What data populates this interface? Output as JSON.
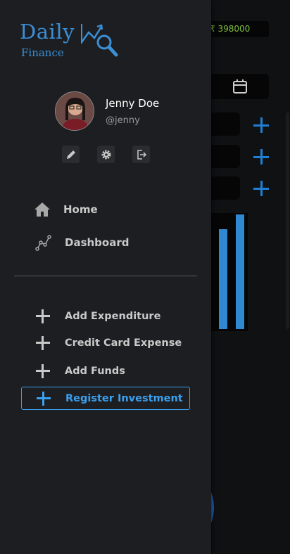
{
  "app": {
    "logo_title": "Daily",
    "logo_subtitle": "Finance",
    "accent": "#3a8fd6",
    "active_accent": "#3aa0f0"
  },
  "background": {
    "balance": "₹ 398000",
    "balance_color": "#7fbf3f"
  },
  "user": {
    "name": "Jenny Doe",
    "handle": "@jenny"
  },
  "profile_actions": [
    {
      "icon": "pencil-icon"
    },
    {
      "icon": "gear-icon"
    },
    {
      "icon": "logout-icon"
    }
  ],
  "nav": {
    "items": [
      {
        "label": "Home",
        "icon": "home-icon"
      },
      {
        "label": "Dashboard",
        "icon": "dashboard-icon"
      }
    ]
  },
  "actions": {
    "items": [
      {
        "label": "Add Expenditure",
        "icon": "plus-icon"
      },
      {
        "label": "Credit Card Expense",
        "icon": "plus-icon"
      },
      {
        "label": "Add Funds",
        "icon": "plus-icon"
      },
      {
        "label": "Register Investment",
        "icon": "plus-icon",
        "active": true
      }
    ]
  }
}
